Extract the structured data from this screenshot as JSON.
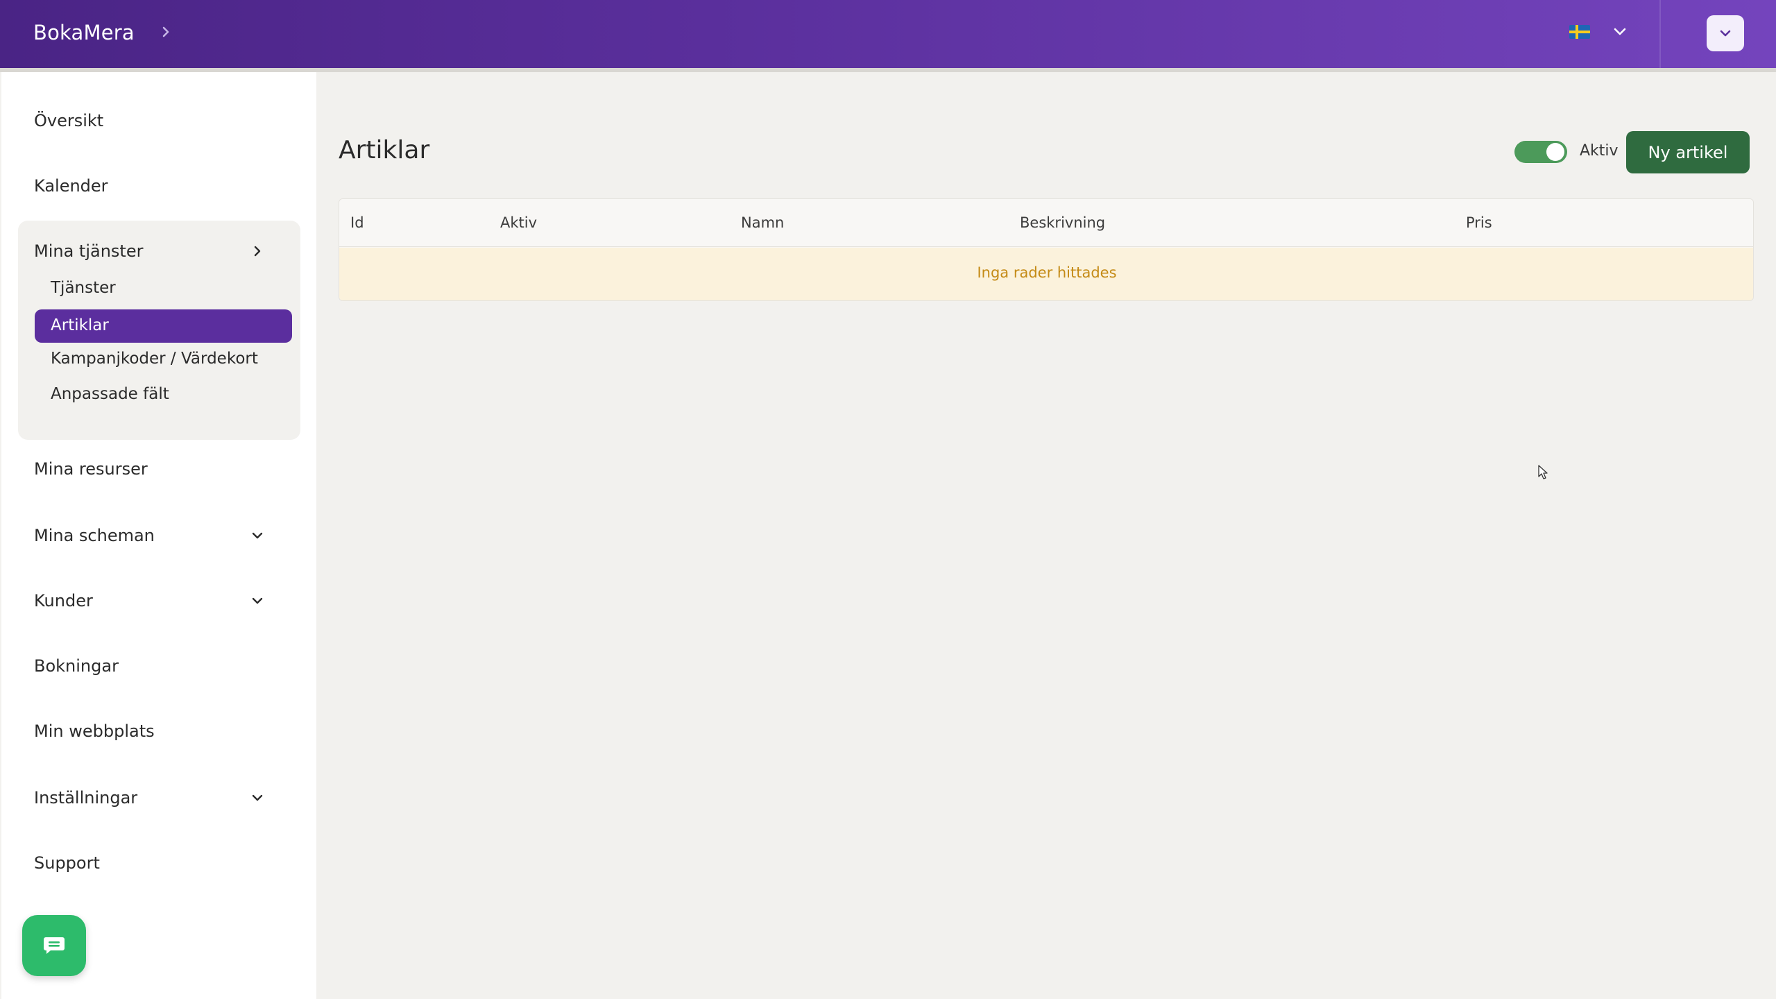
{
  "app": {
    "brand": "BokaMera"
  },
  "header": {
    "language_flag": "sweden-flag",
    "accent_color": "#5a2f9c"
  },
  "sidebar": {
    "items": [
      {
        "label": "Översikt"
      },
      {
        "label": "Kalender"
      },
      {
        "label": "Mina tjänster"
      },
      {
        "label": "Mina resurser"
      },
      {
        "label": "Mina scheman"
      },
      {
        "label": "Kunder"
      },
      {
        "label": "Bokningar"
      },
      {
        "label": "Min webbplats"
      },
      {
        "label": "Inställningar"
      },
      {
        "label": "Support"
      }
    ],
    "sub_items": [
      {
        "label": "Tjänster"
      },
      {
        "label": "Artiklar"
      },
      {
        "label": "Kampanjkoder / Värdekort"
      },
      {
        "label": "Anpassade fält"
      }
    ],
    "active_sub_item": "Artiklar"
  },
  "main": {
    "title": "Artiklar",
    "active_toggle": {
      "label": "Aktiv",
      "on": true
    },
    "new_button_label": "Ny artikel",
    "table": {
      "columns": [
        "Id",
        "Aktiv",
        "Namn",
        "Beskrivning",
        "Pris"
      ],
      "empty_message": "Inga rader hittades"
    }
  }
}
